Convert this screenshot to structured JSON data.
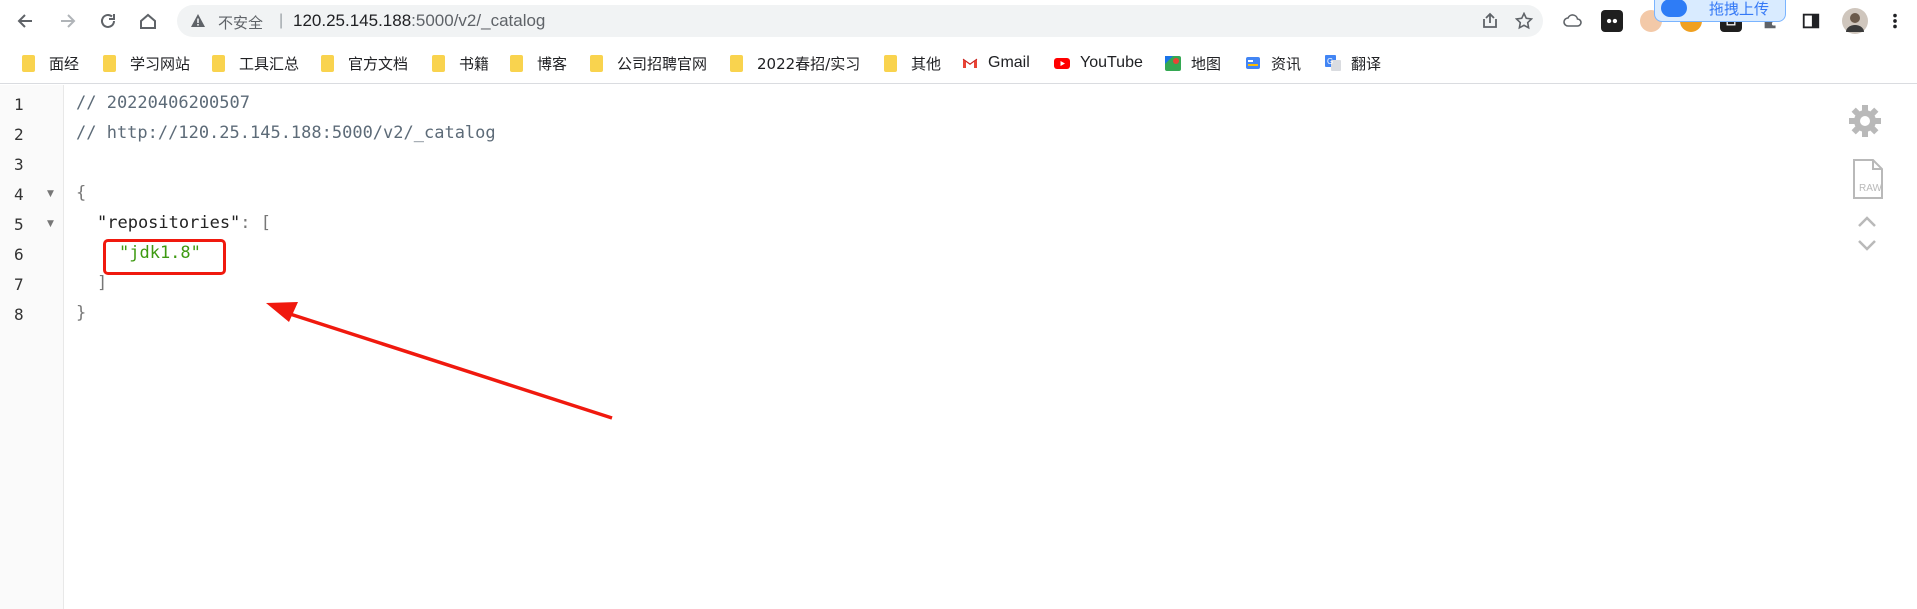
{
  "browser": {
    "security_label": "不安全",
    "separator": "|",
    "url_host": "120.25.145.188",
    "url_path": ":5000/v2/_catalog",
    "upload_badge_label": "拖拽上传"
  },
  "bookmarks": [
    {
      "label": "面经",
      "icon": "folder-icon"
    },
    {
      "label": "学习网站",
      "icon": "folder-icon"
    },
    {
      "label": "工具汇总",
      "icon": "folder-icon"
    },
    {
      "label": "官方文档",
      "icon": "folder-icon"
    },
    {
      "label": "书籍",
      "icon": "folder-icon"
    },
    {
      "label": "博客",
      "icon": "folder-icon"
    },
    {
      "label": "公司招聘官网",
      "icon": "folder-icon"
    },
    {
      "label": "2022春招/实习",
      "icon": "folder-icon"
    },
    {
      "label": "其他",
      "icon": "folder-icon"
    },
    {
      "label": "Gmail",
      "icon": "gmail-icon"
    },
    {
      "label": "YouTube",
      "icon": "youtube-icon"
    },
    {
      "label": "地图",
      "icon": "maps-icon"
    },
    {
      "label": "资讯",
      "icon": "news-icon"
    },
    {
      "label": "翻译",
      "icon": "translate-icon"
    }
  ],
  "viewer": {
    "line_numbers": [
      "1",
      "2",
      "3",
      "4",
      "5",
      "6",
      "7",
      "8"
    ],
    "comment_timestamp": "// 20220406200507",
    "comment_url": "// http://120.25.145.188:5000/v2/_catalog",
    "open_brace": "{",
    "key": "\"repositories\"",
    "colon_bracket": ": [",
    "value": "\"jdk1.8\"",
    "close_bracket": "]",
    "close_brace": "}",
    "raw_label": "RAW"
  },
  "colors": {
    "annotation_red": "#f0190e",
    "string_green": "#3e9a12",
    "folder_yellow": "#f9d34e"
  }
}
